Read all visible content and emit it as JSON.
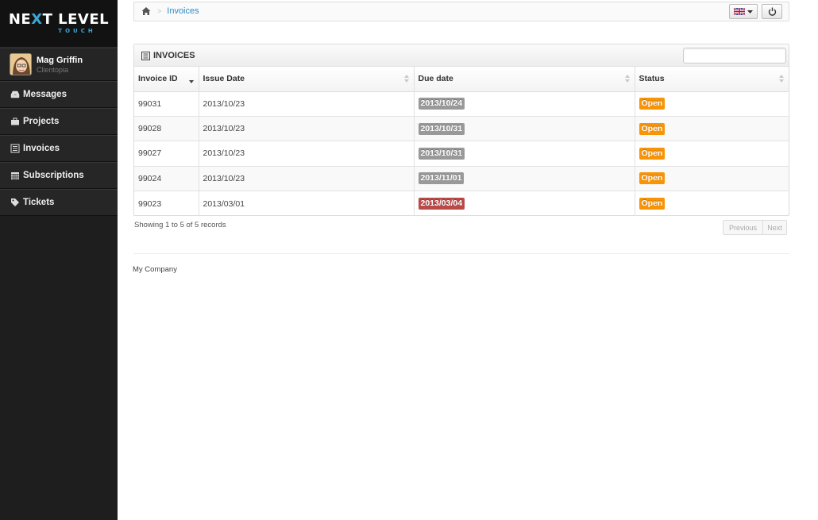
{
  "brand": {
    "logo_main_a": "NE",
    "logo_main_x": "X",
    "logo_main_b": "T LEVEL",
    "logo_sub": "TOUCH"
  },
  "user": {
    "name": "Mag Griffin",
    "company": "Clientopia"
  },
  "nav": {
    "items": [
      {
        "label": "Messages",
        "icon": "inbox-icon"
      },
      {
        "label": "Projects",
        "icon": "briefcase-icon"
      },
      {
        "label": "Invoices",
        "icon": "list-icon"
      },
      {
        "label": "Subscriptions",
        "icon": "calendar-icon"
      },
      {
        "label": "Tickets",
        "icon": "tag-icon"
      }
    ]
  },
  "breadcrumb": {
    "separator": ">",
    "current": "Invoices"
  },
  "panel": {
    "title": "INVOICES",
    "search_value": ""
  },
  "table": {
    "columns": [
      "Invoice ID",
      "Issue Date",
      "Due date",
      "Status"
    ],
    "rows": [
      {
        "id": "99031",
        "issue": "2013/10/23",
        "due": "2013/10/24",
        "due_color": "#999999",
        "status": "Open"
      },
      {
        "id": "99028",
        "issue": "2013/10/23",
        "due": "2013/10/31",
        "due_color": "#999999",
        "status": "Open"
      },
      {
        "id": "99027",
        "issue": "2013/10/23",
        "due": "2013/10/31",
        "due_color": "#999999",
        "status": "Open"
      },
      {
        "id": "99024",
        "issue": "2013/10/23",
        "due": "2013/11/01",
        "due_color": "#999999",
        "status": "Open"
      },
      {
        "id": "99023",
        "issue": "2013/03/01",
        "due": "2013/03/04",
        "due_color": "#b94a48",
        "status": "Open"
      }
    ]
  },
  "pagination": {
    "info": "Showing 1 to 5 of 5 records",
    "previous": "Previous",
    "next": "Next"
  },
  "footer": {
    "text": "My Company"
  },
  "colors": {
    "status_open": "#f89406",
    "accent": "#3aa7d8",
    "sidebar": "#1e1e1e"
  }
}
